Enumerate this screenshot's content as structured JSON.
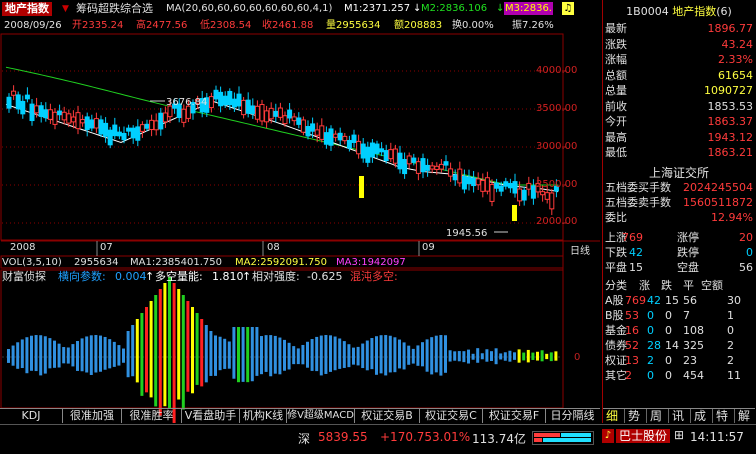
{
  "header": {
    "index_name": "地产指数",
    "indicator_name": "筹码超跌综合选",
    "ma_label": "MA(20,60,60,60,60,60,60,60,4,1)",
    "m1": "M1:2371.257",
    "m2": "M2:2836.106",
    "m3": "M3:2836.",
    "alarm_icon": "bell-icon"
  },
  "info_line": {
    "date": "2008/09/26",
    "open": "开2335.24",
    "high": "高2477.56",
    "low": "低2308.54",
    "close": "收2461.88",
    "volume": "量2955634",
    "amount": "额208883",
    "turnover": "换0.00%",
    "amplitude": "振7.26%"
  },
  "price_axis": [
    "4000.00",
    "3500.00",
    "3000.00",
    "2500.00",
    "2000.00"
  ],
  "annotations": {
    "peak": "3676.84",
    "trough": "1945.56"
  },
  "date_axis": [
    "2008",
    "07",
    "08",
    "09"
  ],
  "daily_label": "日线",
  "vol_line": {
    "label": "VOL(3,5,10)",
    "value": "2955634",
    "ma1": "MA1:2385401.750",
    "ma2": "MA2:2592091.750",
    "ma3": "MA3:1942097"
  },
  "indicator_line": {
    "name": "财富侦探",
    "hx_label": "横向参数:",
    "hx_value": "0.004",
    "dk_label": "多空量能:",
    "dk_value": "1.810",
    "xd_label": "相对强度:",
    "xd_value": "-0.625",
    "hd_label": "混沌多空:"
  },
  "osc_axis": "0",
  "bottom_tabs": [
    "KDJ",
    "很准加强",
    "很准胜率",
    "V看盘助手",
    "机构K线",
    "修V超级MACD",
    "权证交易B",
    "权证交易C",
    "权证交易F",
    "日分隔线"
  ],
  "quote": {
    "code": "1B0004",
    "name": "地产指数",
    "suffix": "(6)",
    "rows": [
      {
        "label": "最新",
        "value": "1896.77",
        "color": "#ff3b3b"
      },
      {
        "label": "涨跌",
        "value": "43.24",
        "color": "#ff3b3b"
      },
      {
        "label": "涨幅",
        "value": "2.33%",
        "color": "#ff3b3b"
      },
      {
        "label": "总额",
        "value": "61654",
        "color": "#ffff40"
      },
      {
        "label": "总量",
        "value": "1090727",
        "color": "#ffff40"
      },
      {
        "label": "前收",
        "value": "1853.53",
        "color": "#e0e0e0"
      },
      {
        "label": "今开",
        "value": "1863.37",
        "color": "#ff3b3b"
      },
      {
        "label": "最高",
        "value": "1943.12",
        "color": "#ff3b3b"
      },
      {
        "label": "最低",
        "value": "1863.21",
        "color": "#ff3b3b"
      }
    ],
    "exchange": "上海证交所",
    "orders": [
      {
        "label": "五档委买手数",
        "value": "2024245504"
      },
      {
        "label": "五档委卖手数",
        "value": "1560511872"
      },
      {
        "label": "委比",
        "value": "12.94%"
      }
    ],
    "breadth": [
      {
        "a": "上涨",
        "av": "769",
        "b": "涨停",
        "bv": "20"
      },
      {
        "a": "下跌",
        "av": "42",
        "b": "跌停",
        "bv": "0"
      },
      {
        "a": "平盘",
        "av": "15",
        "b": "空盘",
        "bv": "56"
      }
    ],
    "table_header": [
      "分类",
      "涨",
      "跌",
      "平",
      "空额"
    ],
    "table_rows": [
      [
        "A股",
        "769",
        "42",
        "15",
        "56",
        "30"
      ],
      [
        "B股",
        "53",
        "0",
        "0",
        "7",
        "1"
      ],
      [
        "基金",
        "16",
        "0",
        "0",
        "108",
        "0"
      ],
      [
        "债券",
        "52",
        "28",
        "14",
        "325",
        "2"
      ],
      [
        "权证",
        "13",
        "2",
        "0",
        "23",
        "2"
      ],
      [
        "其它",
        "2",
        "0",
        "0",
        "454",
        "11"
      ]
    ],
    "side_tabs": [
      "细",
      "势",
      "周",
      "讯",
      "成",
      "特",
      "解"
    ]
  },
  "status": {
    "index": "深",
    "index_value": "5839.55",
    "change": "+170.75",
    "pct": "3.01%",
    "amount": "113.74亿",
    "stock": "巴士股份",
    "time": "14:11:57"
  },
  "colors": {
    "up": "#ff3b3b",
    "down": "#00d0ff",
    "ma1": "#ffffff",
    "ma2": "#20d020",
    "ma3": "#ffff00",
    "grid": "#8b0000"
  }
}
